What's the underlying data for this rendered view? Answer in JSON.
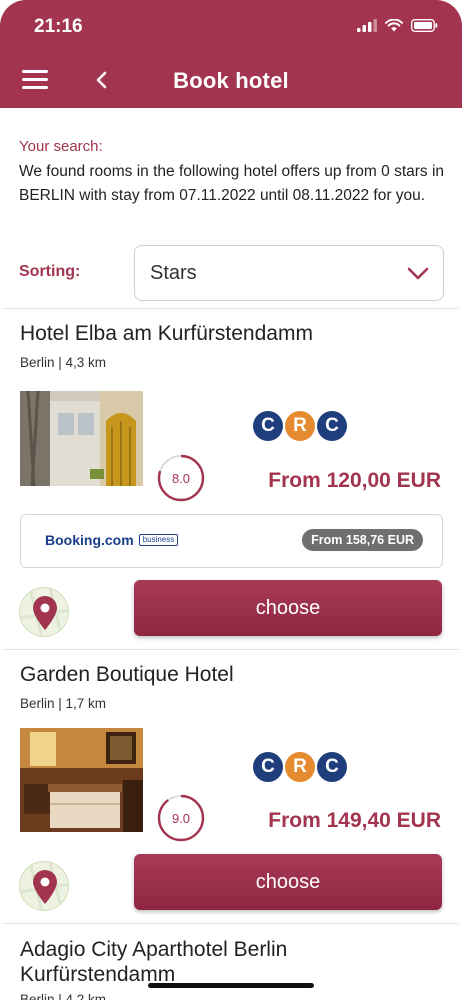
{
  "status_bar": {
    "time": "21:16"
  },
  "header": {
    "title": "Book hotel",
    "menu_icon": "hamburger-menu-icon",
    "back_icon": "chevron-left-icon"
  },
  "search": {
    "label": "Your search:",
    "description": "We found rooms in the following hotel offers up from 0 stars in BERLIN with stay from 07.11.2022 until 08.11.2022 for you.",
    "sorting_label": "Sorting:",
    "sorting_value": "Stars"
  },
  "hotels": [
    {
      "name": "Hotel Elba am Kurfürstendamm",
      "location": "Berlin | 4,3 km",
      "rating": "8.0",
      "rating_value": 8.0,
      "price": "From 120,00 EUR",
      "partner": {
        "logo": "Booking.com",
        "tag": "business",
        "price": "From 158,76 EUR"
      },
      "choose_label": "choose"
    },
    {
      "name": "Garden Boutique Hotel",
      "location": "Berlin | 1,7 km",
      "rating": "9.0",
      "rating_value": 9.0,
      "price": "From 149,40 EUR",
      "choose_label": "choose"
    },
    {
      "name": "Adagio City Aparthotel Berlin Kurfürstendamm",
      "location": "Berlin | 4,2 km"
    }
  ],
  "crc_letters": [
    "C",
    "R",
    "C"
  ],
  "colors": {
    "brand": "#a3344f",
    "crc_blue": "#1e3e7c",
    "crc_orange": "#e58a2f",
    "pill_gray": "#6f6f6f"
  }
}
